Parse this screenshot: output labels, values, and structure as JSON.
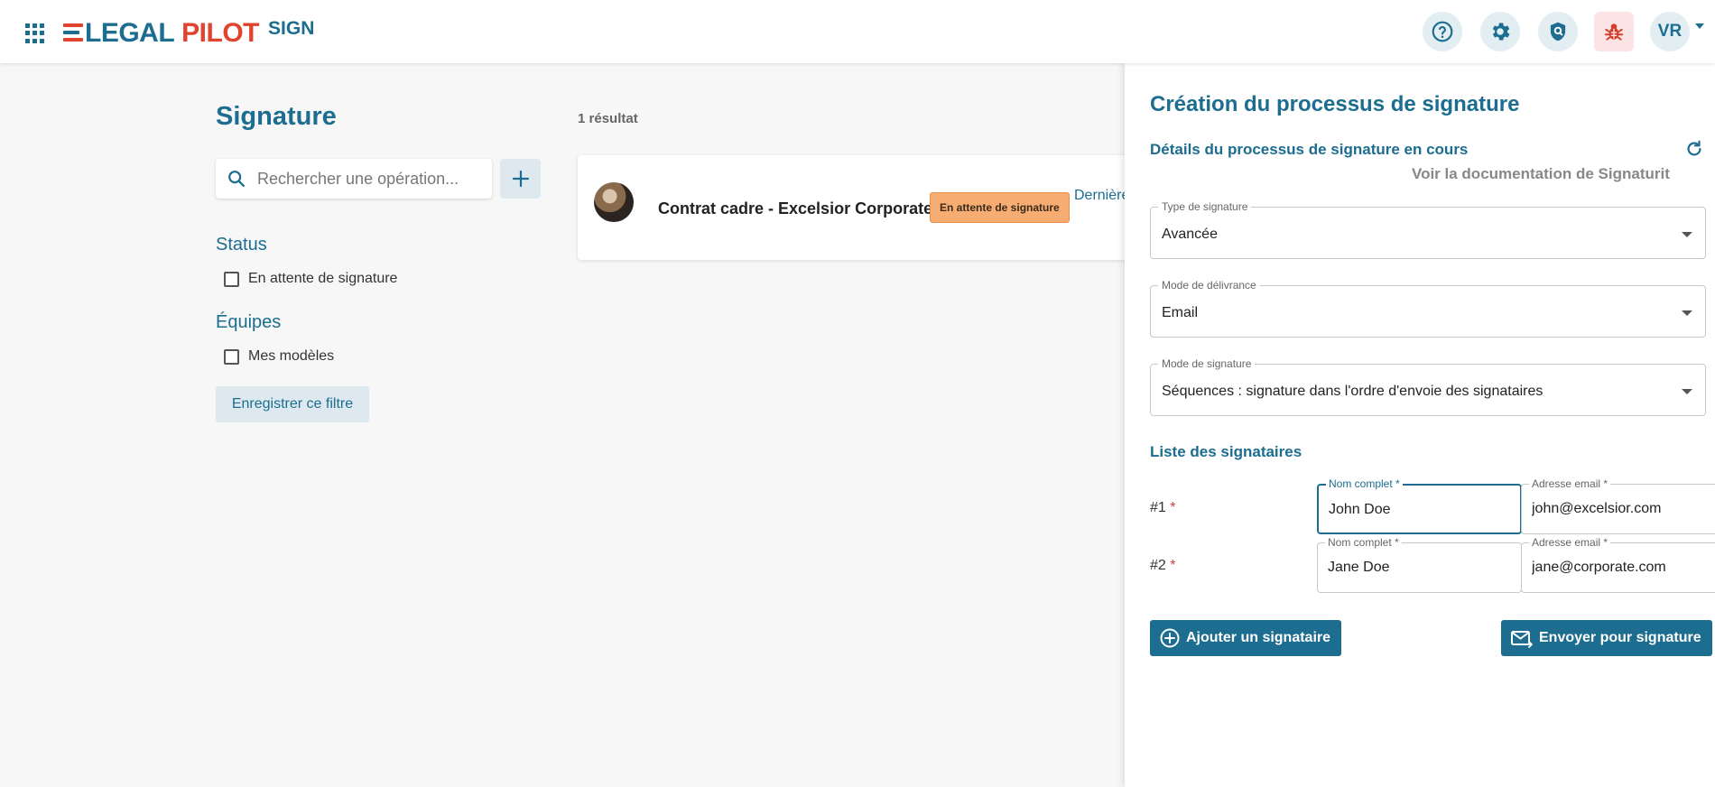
{
  "header": {
    "logo_legal": "LEGAL",
    "logo_pilot": "PILOT",
    "logo_sign": "SIGN",
    "avatar_initials": "VR",
    "icons": [
      "apps-grid-icon",
      "help-icon",
      "gear-icon",
      "shield-icon",
      "bug-icon"
    ]
  },
  "sidebar": {
    "title": "Signature",
    "search_placeholder": "Rechercher une opération...",
    "status_title": "Status",
    "status_option": "En attente de signature",
    "teams_title": "Équipes",
    "teams_option": "Mes modèles",
    "save_filter": "Enregistrer ce filtre"
  },
  "results": {
    "count": "1 résultat",
    "items": [
      {
        "title": "Contrat cadre - Excelsior Corporate",
        "badge": "En attente de signature",
        "last": "Dernière"
      }
    ]
  },
  "panel": {
    "title": "Création du processus de signature",
    "subtitle": "Détails du processus de signature en cours",
    "doc_link": "Voir la documentation de Signaturit",
    "type_label": "Type de signature",
    "type_value": "Avancée",
    "delivery_label": "Mode de délivrance",
    "delivery_value": "Email",
    "mode_label": "Mode de signature",
    "mode_value": "Séquences : signature dans l'ordre d'envoie des signataires",
    "list_title": "Liste des signataires",
    "signers": [
      {
        "num": "#1",
        "name_label": "Nom complet *",
        "name": "John Doe",
        "email_label": "Adresse email *",
        "email": "john@excelsior.com"
      },
      {
        "num": "#2",
        "name_label": "Nom complet *",
        "name": "Jane Doe",
        "email_label": "Adresse email *",
        "email": "jane@corporate.com"
      }
    ],
    "add_signer": "Ajouter un signataire",
    "send": "Envoyer pour signature"
  },
  "colors": {
    "brand": "#1c6d8f",
    "accent_red": "#e1432f",
    "badge": "#f7ad72"
  }
}
